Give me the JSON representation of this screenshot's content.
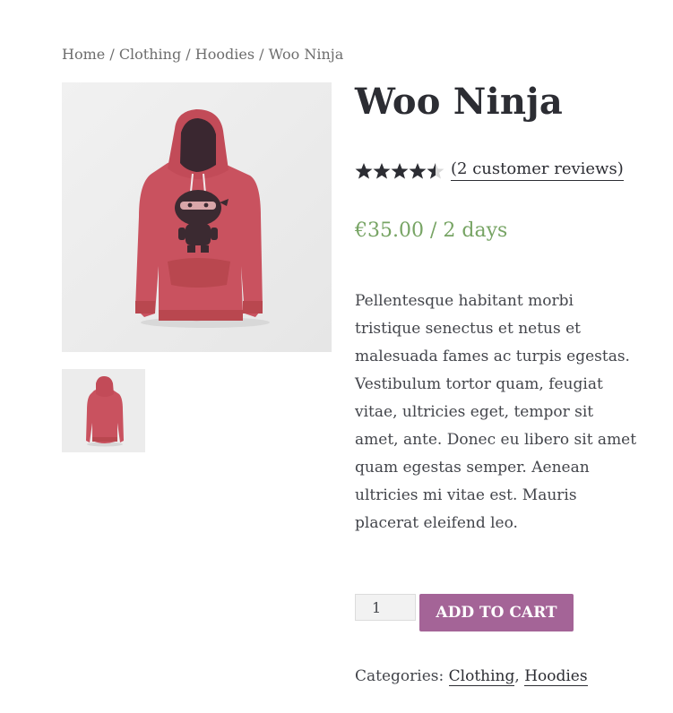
{
  "breadcrumb": {
    "items": [
      "Home",
      "Clothing",
      "Hoodies",
      "Woo Ninja"
    ],
    "separator": "/"
  },
  "product": {
    "title": "Woo Ninja",
    "rating": 4.5,
    "rating_max": 5,
    "reviews_link": "(2 customer reviews)",
    "price": "€35.00 / 2 days",
    "description": "Pellentesque habitant morbi tristique senectus et netus et malesuada fames ac turpis egestas. Vestibulum tortor quam, feugiat vitae, ultricies eget, tempor sit amet, ante. Donec eu libero sit amet quam egestas semper. Aenean ultricies mi vitae est. Mauris placerat eleifend leo.",
    "quantity": "1",
    "add_to_cart_label": "ADD TO CART",
    "categories_label": "Categories:",
    "categories": [
      "Clothing",
      "Hoodies"
    ],
    "categories_separator": ","
  },
  "images": {
    "main_icon": "hoodie-ninja-front-image",
    "thumb_icon": "hoodie-back-thumbnail"
  },
  "colors": {
    "price": "#77a464",
    "button": "#a46497",
    "hoodie": "#c9525f"
  }
}
